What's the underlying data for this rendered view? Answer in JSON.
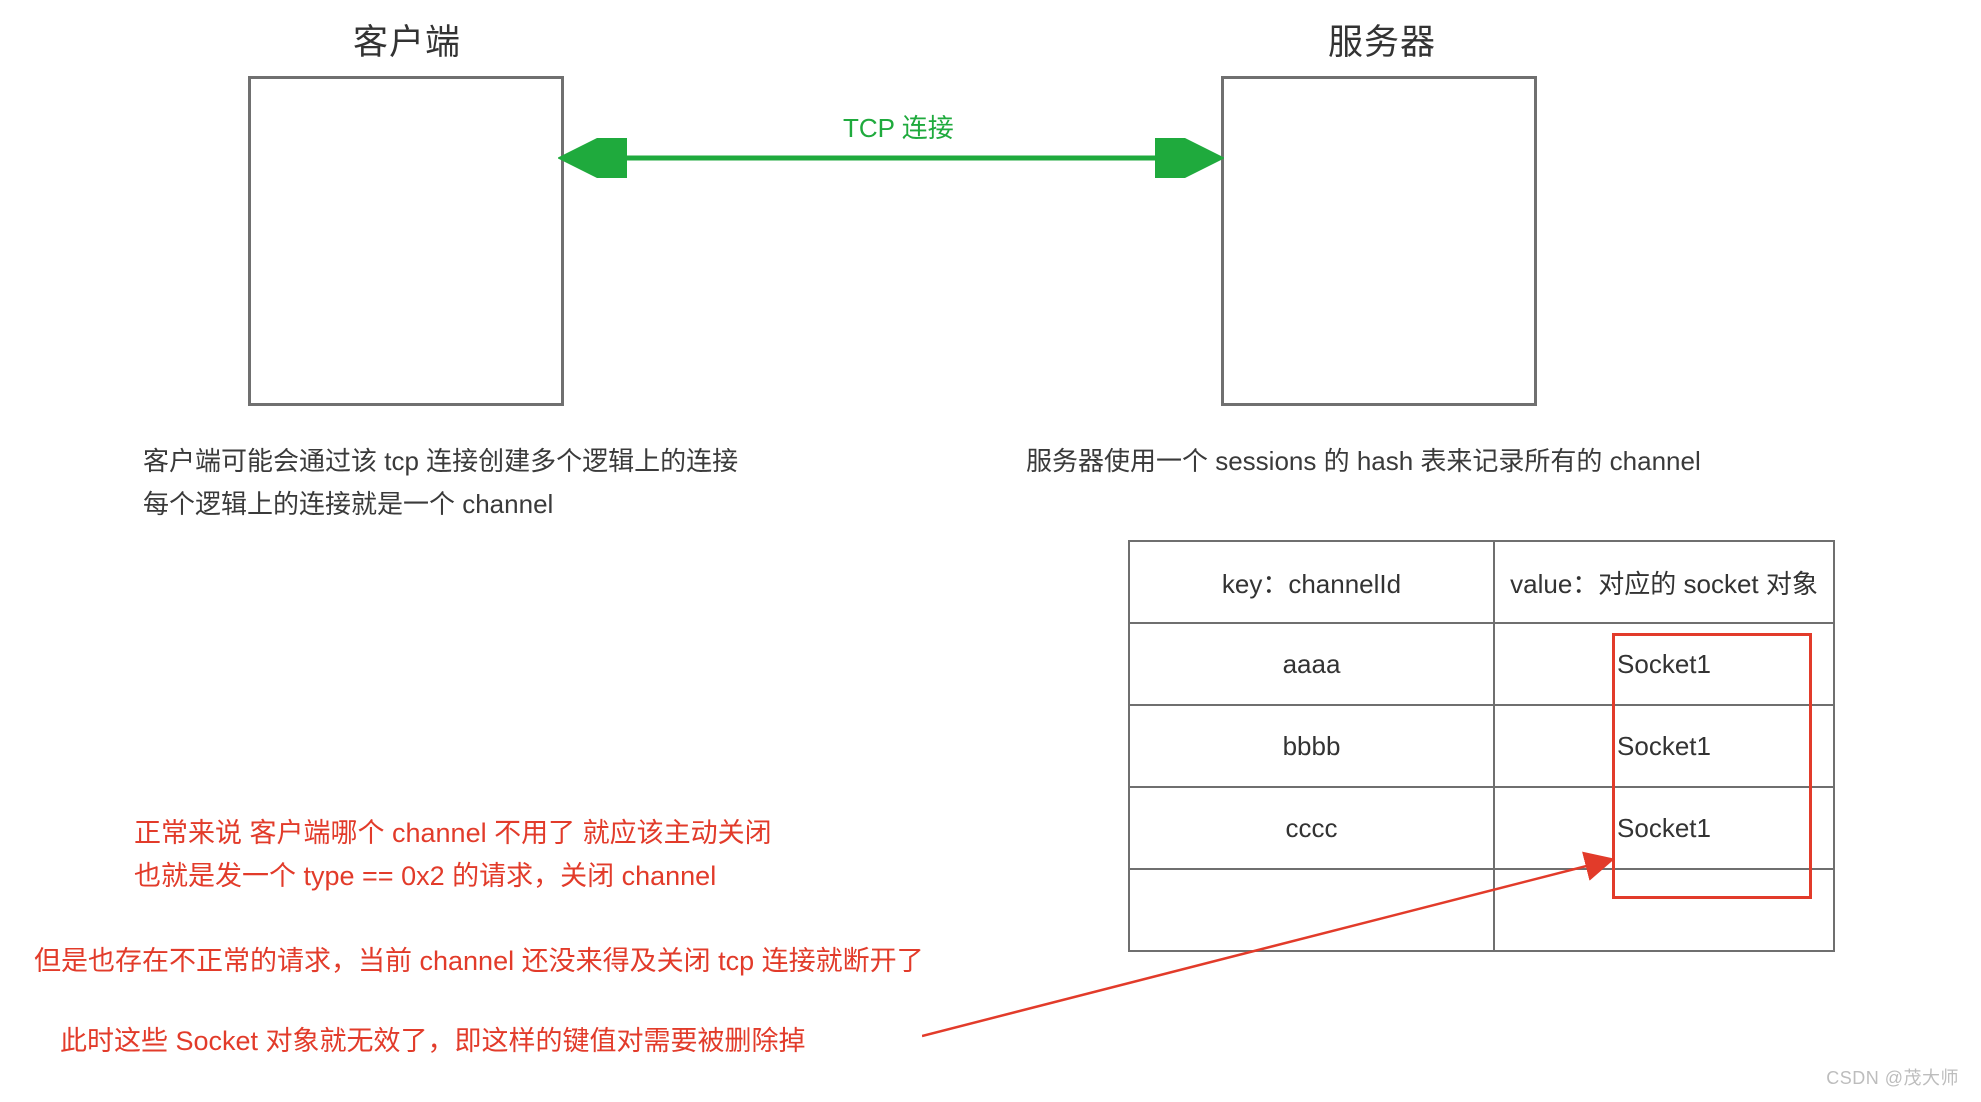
{
  "client": {
    "title": "客户端",
    "desc_line1": "客户端可能会通过该 tcp 连接创建多个逻辑上的连接",
    "desc_line2": "每个逻辑上的连接就是一个 channel"
  },
  "server": {
    "title": "服务器",
    "desc": "服务器使用一个 sessions 的 hash 表来记录所有的 channel"
  },
  "connection": {
    "label": "TCP 连接"
  },
  "table": {
    "header_key": "key：channelId",
    "header_value": "value：对应的 socket 对象",
    "rows": [
      {
        "key": "aaaa",
        "value": "Socket1"
      },
      {
        "key": "bbbb",
        "value": "Socket1"
      },
      {
        "key": "cccc",
        "value": "Socket1"
      },
      {
        "key": "",
        "value": ""
      }
    ]
  },
  "notes": {
    "n1_line1": "正常来说 客户端哪个 channel 不用了 就应该主动关闭",
    "n1_line2": "也就是发一个 type == 0x2 的请求，关闭 channel",
    "n2": "但是也存在不正常的请求，当前 channel 还没来得及关闭 tcp 连接就断开了",
    "n3": "此时这些 Socket 对象就无效了，即这样的键值对需要被删除掉"
  },
  "watermark": "CSDN @茂大师"
}
